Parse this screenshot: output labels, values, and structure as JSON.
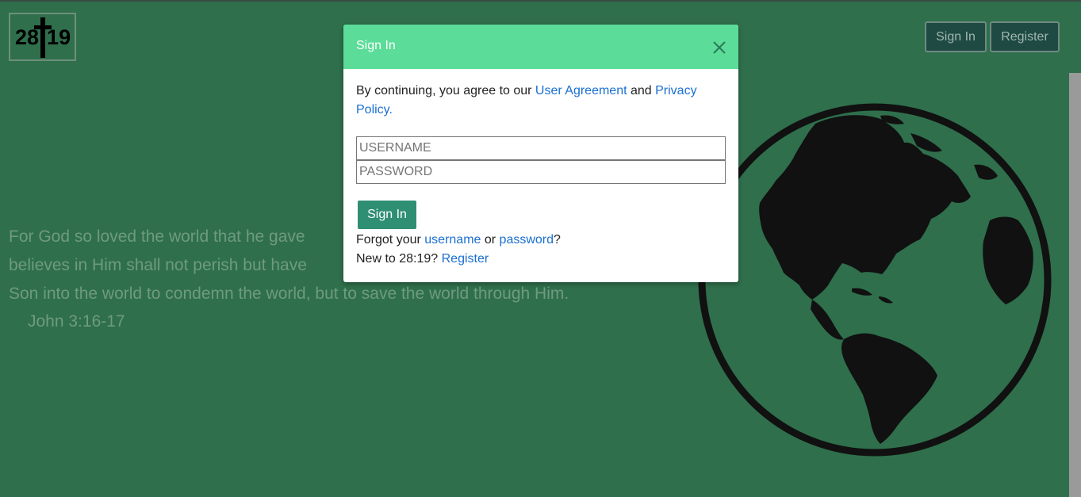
{
  "logo": {
    "text_left": "28",
    "text_right": "19"
  },
  "nav": {
    "signin_label": "Sign In",
    "register_label": "Register"
  },
  "verse": {
    "line1": "For God so loved the world that he gave",
    "line2": "believes in Him shall not perish but have",
    "line3": "Son into the world to condemn the world, but to save the world through Him.",
    "reference": "John 3:16-17"
  },
  "modal": {
    "title": "Sign In",
    "agree_prefix": "By continuing, you agree to our ",
    "user_agreement": "User Agreement",
    "agree_and": " and ",
    "privacy_policy": "Privacy Policy",
    "agree_suffix": ".",
    "username_placeholder": "USERNAME",
    "password_placeholder": "PASSWORD",
    "submit_label": "Sign In",
    "forgot_prefix": "Forgot your ",
    "forgot_username": "username",
    "forgot_or": " or ",
    "forgot_password": "password",
    "forgot_suffix": "?",
    "new_prefix": "New to 28:19? ",
    "new_register": "Register"
  },
  "colors": {
    "background": "#2f6f4c",
    "modal_header": "#5bdc98",
    "submit_button": "#2f8f72",
    "link": "#1a6fd0"
  },
  "icons": {
    "close": "close-icon",
    "globe": "globe-icon",
    "cross": "cross-icon"
  }
}
